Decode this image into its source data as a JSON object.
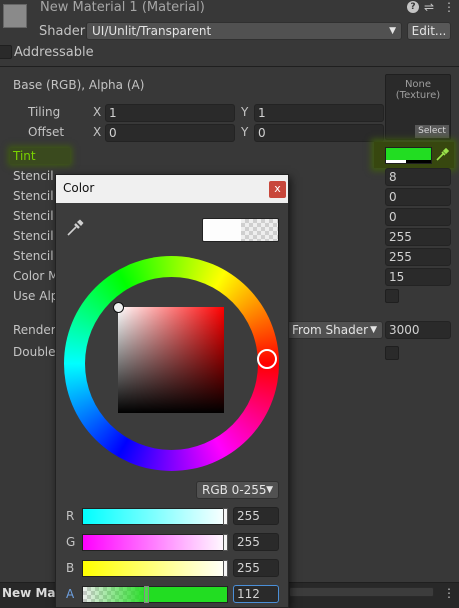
{
  "header": {
    "material_name": "New Material 1 (Material)",
    "shader_label": "Shader",
    "shader_value": "UI/Unlit/Transparent",
    "edit_label": "Edit...",
    "addressable_label": "Addressable",
    "help_icon": "help-icon",
    "settings_icon": "sliders-icon",
    "menu_icon": "kebab-menu-icon"
  },
  "texture": {
    "label": "Base (RGB), Alpha (A)",
    "slot_text": "None\n(Texture)",
    "select_label": "Select",
    "tiling_label": "Tiling",
    "offset_label": "Offset",
    "x_label": "X",
    "y_label": "Y",
    "tiling_x": "1",
    "tiling_y": "1",
    "offset_x": "0",
    "offset_y": "0"
  },
  "properties": {
    "tint_label": "Tint",
    "tint_color": "#22dd22",
    "rows": [
      {
        "label": "Stencil",
        "value": "8"
      },
      {
        "label": "Stencil",
        "value": "0"
      },
      {
        "label": "Stencil",
        "value": "0"
      },
      {
        "label": "Stencil",
        "value": "255"
      },
      {
        "label": "Stencil",
        "value": "255"
      },
      {
        "label": "Color M",
        "value": "15"
      }
    ],
    "use_alpha_label": "Use Alp",
    "render_label": "Render",
    "render_dropdown": "From Shader",
    "render_value": "3000",
    "double_label": "Double"
  },
  "footer": {
    "tab_label": "New Mate"
  },
  "color_picker": {
    "title": "Color",
    "close_label": "x",
    "mode_label": "RGB 0-255",
    "channels": [
      {
        "label": "R",
        "value": "255",
        "level": 1.0
      },
      {
        "label": "G",
        "value": "255",
        "level": 1.0
      },
      {
        "label": "B",
        "value": "255",
        "level": 1.0
      },
      {
        "label": "A",
        "value": "112",
        "level": 0.44
      }
    ],
    "hue_deg": 0,
    "saturation": 0.0,
    "brightness": 1.0
  }
}
